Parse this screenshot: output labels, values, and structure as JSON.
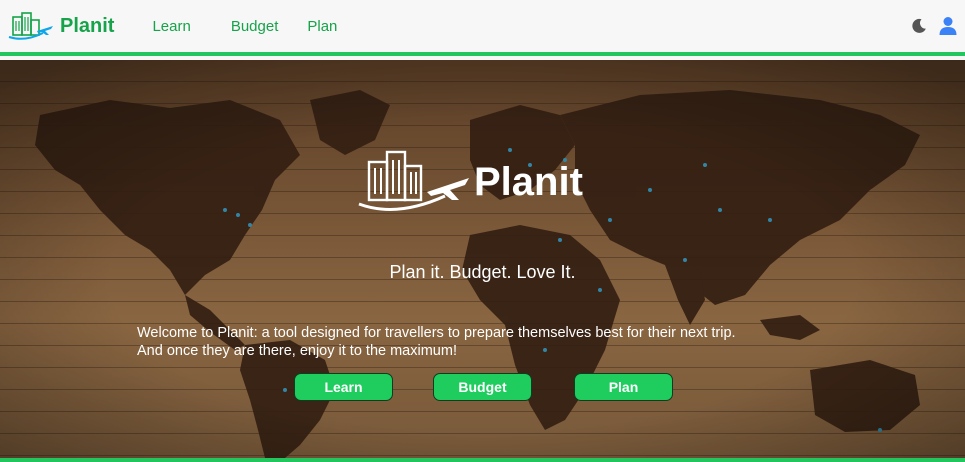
{
  "brand": {
    "name": "Planit",
    "icon": "planit-logo-icon"
  },
  "nav": {
    "links": [
      {
        "label": "Learn"
      },
      {
        "label": "Budget"
      },
      {
        "label": "Plan"
      }
    ]
  },
  "nav_icons": {
    "theme": "moon-icon",
    "account": "user-icon"
  },
  "hero": {
    "logo_text": "Planit",
    "tagline": "Plan it. Budget. Love It.",
    "welcome_line1": "Welcome to Planit: a tool designed for travellers to prepare themselves best for their next trip.",
    "welcome_line2": "And once they are there, enjoy it to the maximum!",
    "buttons": [
      {
        "label": "Learn"
      },
      {
        "label": "Budget"
      },
      {
        "label": "Plan"
      }
    ]
  },
  "colors": {
    "accent": "#22c55e",
    "brand_text": "#16a34a",
    "button": "#1fcc5e",
    "navbar_bg": "#f7f7f7",
    "user_icon": "#3b82f6",
    "map_land": "#3a2416",
    "map_wood": "#9a7046"
  }
}
